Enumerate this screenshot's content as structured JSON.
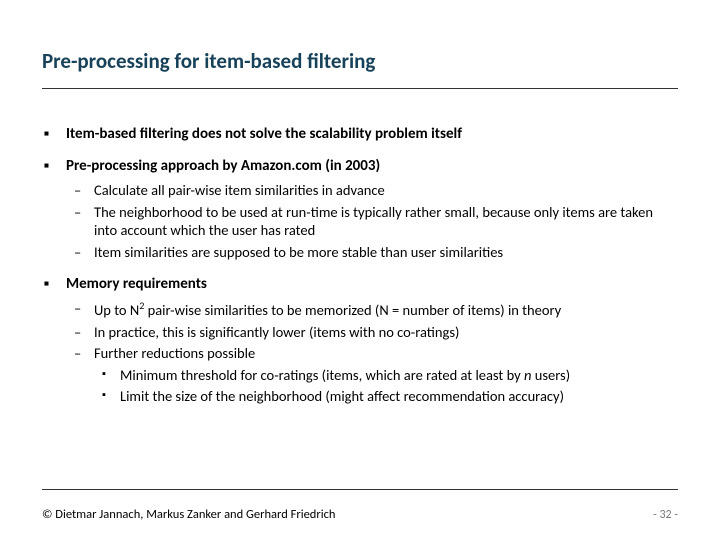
{
  "title": "Pre-processing for item-based filtering",
  "bullets": {
    "b1": "Item-based filtering does not solve the scalability problem itself",
    "b2": "Pre-processing approach by Amazon.com (in 2003)",
    "b2s": {
      "s1": "Calculate all pair-wise item similarities in advance",
      "s2": "The neighborhood to be used at run-time is typically rather small, because only items are taken into account which the user has rated",
      "s3": "Item similarities are supposed to be more stable than user similarities"
    },
    "b3": "Memory requirements",
    "b3s": {
      "s1a": "Up to N",
      "s1b": " pair-wise similarities to be memorized (N = number of items) in theory",
      "s2": "In practice, this is significantly lower (items with no co-ratings)",
      "s3": "Further reductions possible",
      "s3sub": {
        "a1": "Minimum threshold for co-ratings (items, which are rated at least by ",
        "a1n": "n",
        "a1end": " users)",
        "a2": "Limit the size of the neighborhood (might affect recommendation accuracy)"
      }
    }
  },
  "footer": {
    "copyright": "© Dietmar Jannach, Markus Zanker and Gerhard Friedrich",
    "page": "- 32 -"
  }
}
